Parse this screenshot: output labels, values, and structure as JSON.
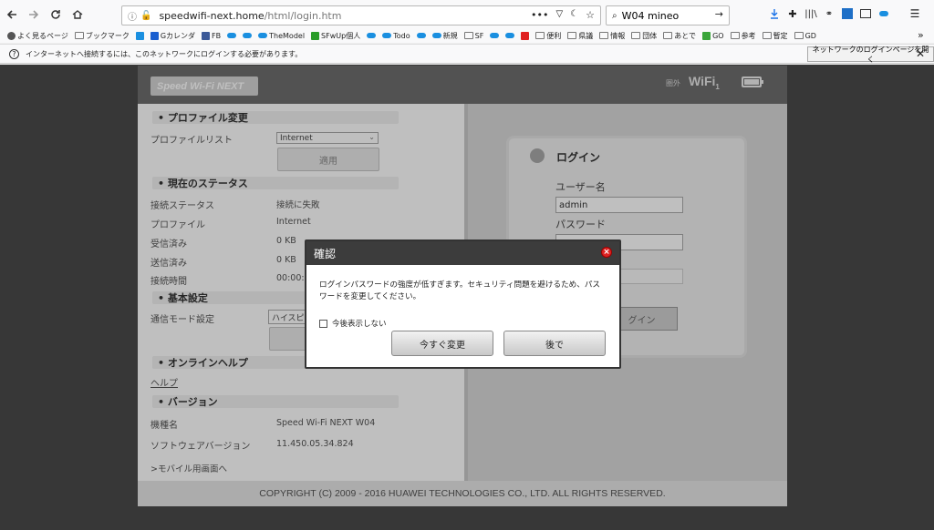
{
  "browser": {
    "url_host": "speedwifi-next.home",
    "url_path": "/html/login.htm",
    "search_value": "W04 mineo",
    "bookmarks": [
      {
        "label": "よく見るページ",
        "icon": "gear-icon"
      },
      {
        "label": "ブックマーク",
        "icon": "folder-icon"
      },
      {
        "label": "",
        "icon": "link-icon"
      },
      {
        "label": "Gカレンダ",
        "icon": "calendar-icon"
      },
      {
        "label": "FB",
        "icon": "facebook-icon"
      },
      {
        "label": "",
        "icon": "cloud-icon"
      },
      {
        "label": "",
        "icon": "cloud-icon"
      },
      {
        "label": "TheModel",
        "icon": "cloud-icon"
      },
      {
        "label": "SFwUp個人",
        "icon": "sf-icon"
      },
      {
        "label": "",
        "icon": "cloud-icon"
      },
      {
        "label": "Todo",
        "icon": "cloud-icon"
      },
      {
        "label": "",
        "icon": "cloud-icon"
      },
      {
        "label": "新規",
        "icon": "cloud-icon"
      },
      {
        "label": "SF",
        "icon": "folder-icon"
      },
      {
        "label": "",
        "icon": "cloud-icon"
      },
      {
        "label": "",
        "icon": "cloud-icon"
      },
      {
        "label": "",
        "icon": "youtube-icon"
      },
      {
        "label": "便利",
        "icon": "folder-icon"
      },
      {
        "label": "県議",
        "icon": "folder-icon"
      },
      {
        "label": "情報",
        "icon": "folder-icon"
      },
      {
        "label": "団体",
        "icon": "folder-icon"
      },
      {
        "label": "あとで",
        "icon": "folder-icon"
      },
      {
        "label": "GO",
        "icon": "frog-icon"
      },
      {
        "label": "参考",
        "icon": "folder-icon"
      },
      {
        "label": "暫定",
        "icon": "folder-icon"
      },
      {
        "label": "GD",
        "icon": "folder-icon"
      }
    ],
    "notice_text": "インターネットへ接続するには、このネットワークにログインする必要があります。",
    "notice_button": "ネットワークのログインページを開く"
  },
  "header": {
    "logo": "Speed Wi-Fi NEXT",
    "signal_status": "圏外",
    "wifi_label": "WiFi",
    "wifi_sub": "1"
  },
  "left": {
    "profile_section": "プロファイル変更",
    "profile_list_label": "プロファイルリスト",
    "profile_list_value": "Internet",
    "apply_button": "適用",
    "status_section": "現在のステータス",
    "rows": [
      {
        "label": "接続ステータス",
        "value": "接続に失敗"
      },
      {
        "label": "プロファイル",
        "value": "Internet"
      },
      {
        "label": "受信済み",
        "value": "0 KB"
      },
      {
        "label": "送信済み",
        "value": "0 KB"
      },
      {
        "label": "接続時間",
        "value": "00:00:0"
      }
    ],
    "basic_section": "基本設定",
    "comm_mode_label": "通信モード設定",
    "comm_mode_value": "ハイスピ",
    "help_section": "オンラインヘルプ",
    "help_link": "ヘルプ",
    "version_section": "バージョン",
    "model_label": "機種名",
    "model_value": "Speed Wi-Fi NEXT W04",
    "software_label": "ソフトウェアバージョン",
    "software_value": "11.450.05.34.824",
    "mobile_link": ">モバイル用画面へ"
  },
  "login": {
    "title": "ログイン",
    "username_label": "ユーザー名",
    "username_value": "admin",
    "password_label": "パスワード",
    "password_value": "",
    "login_button": "グイン"
  },
  "footer": {
    "copyright": "COPYRIGHT (C) 2009 - 2016 HUAWEI TECHNOLOGIES CO., LTD. ALL RIGHTS RESERVED."
  },
  "modal": {
    "title": "確認",
    "message": "ログインパスワードの強度が低すぎます。セキュリティ問題を避けるため、パスワードを変更してください。",
    "checkbox_label": "今後表示しない",
    "change_now_button": "今すぐ変更",
    "later_button": "後で"
  }
}
